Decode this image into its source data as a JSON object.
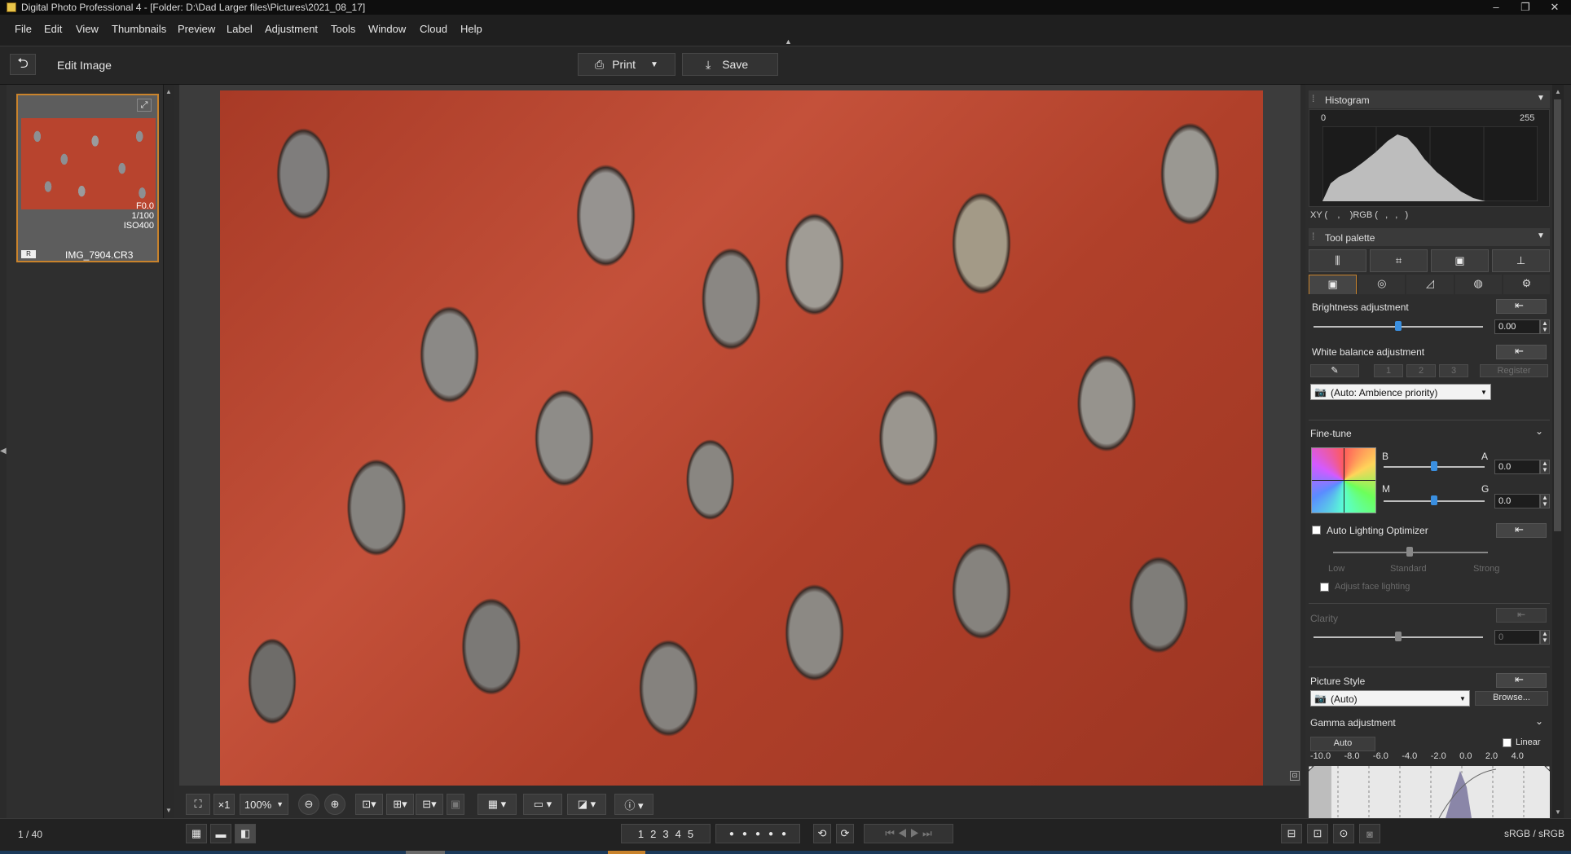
{
  "window": {
    "title": "Digital Photo Professional 4 - [Folder: D:\\Dad Larger files\\Pictures\\2021_08_17]",
    "minimize": "–",
    "maximize": "❐",
    "close": "✕"
  },
  "menu": [
    "File",
    "Edit",
    "View",
    "Thumbnails",
    "Preview",
    "Label",
    "Adjustment",
    "Tools",
    "Window",
    "Cloud",
    "Help"
  ],
  "toolbar": {
    "mode_label": "Edit Image",
    "print_label": "Print",
    "save_label": "Save"
  },
  "thumbnail": {
    "filename": "IMG_7904.CR3",
    "aperture": "F0.0",
    "shutter": "1/100",
    "iso": "ISO400",
    "badge": "R"
  },
  "viewer": {
    "zoom": "100%",
    "scale_label": "×1"
  },
  "histogram": {
    "title": "Histogram",
    "min": "0",
    "max": "255",
    "readout": "XY (    ,    )RGB (   ,   ,   )"
  },
  "tool_palette": {
    "title": "Tool palette",
    "brightness": {
      "label": "Brightness adjustment",
      "value": "0.00"
    },
    "white_balance": {
      "label": "White balance adjustment",
      "btn1": "1",
      "btn2": "2",
      "btn3": "3",
      "register": "Register",
      "mode": "(Auto: Ambience priority)"
    },
    "fine_tune": {
      "label": "Fine-tune",
      "b": "B",
      "a": "A",
      "m": "M",
      "g": "G",
      "value_a": "0.0",
      "value_g": "0.0"
    },
    "alo": {
      "label": "Auto Lighting Optimizer",
      "low": "Low",
      "standard": "Standard",
      "strong": "Strong",
      "face": "Adjust face lighting"
    },
    "clarity": {
      "label": "Clarity",
      "value": "0"
    },
    "picture_style": {
      "label": "Picture Style",
      "value": "(Auto)",
      "browse": "Browse..."
    },
    "gamma": {
      "label": "Gamma adjustment",
      "auto": "Auto",
      "linear": "Linear",
      "ticks": [
        "-10.0",
        "-8.0",
        "-6.0",
        "-4.0",
        "-2.0",
        "0.0",
        "2.0",
        "4.0"
      ]
    }
  },
  "status": {
    "count": "1 / 40",
    "ratings": [
      "1",
      "2",
      "3",
      "4",
      "5"
    ],
    "colorspace": "sRGB / sRGB"
  }
}
